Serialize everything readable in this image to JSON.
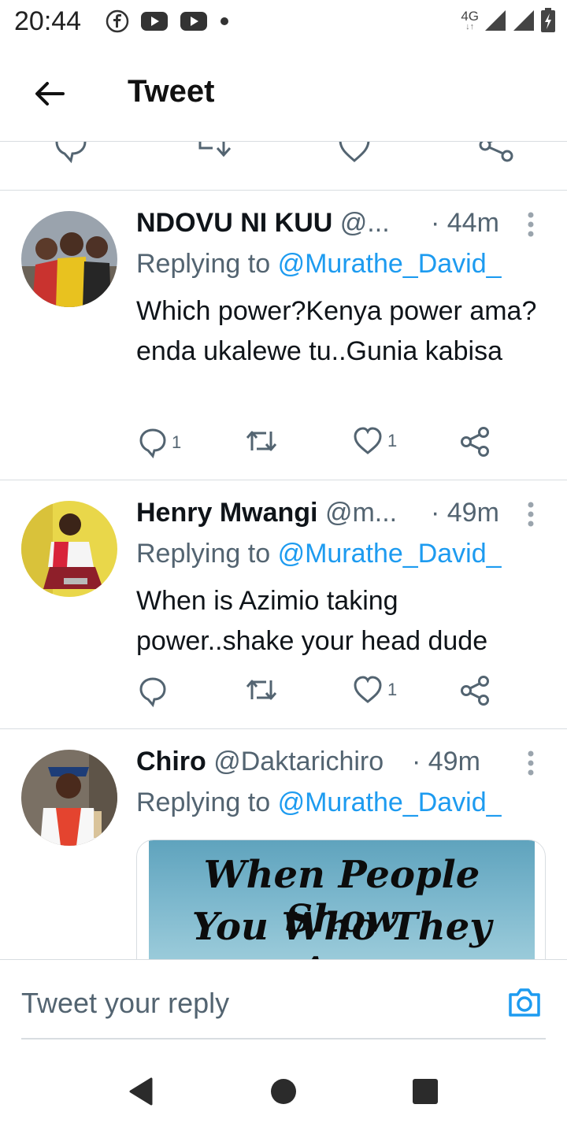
{
  "status_bar": {
    "time": "20:44",
    "left_icons": [
      "facebook-icon",
      "youtube-icon",
      "youtube-icon",
      "dot-icon"
    ],
    "network": "4G",
    "right_icons": [
      "signal-icon",
      "signal-icon",
      "battery-charging-icon"
    ]
  },
  "header": {
    "title": "Tweet",
    "back_icon": "back-arrow-icon"
  },
  "tweets": [
    {
      "name": "NDOVU NI KUU",
      "handle": "@...",
      "time": "· 44m",
      "replying_prefix": "Replying to",
      "replying_to": "@Murathe_David_",
      "text": "Which power?Kenya power ama?enda ukalewe tu..Gunia kabisa",
      "replies": "1",
      "retweets": "",
      "likes": "1"
    },
    {
      "name": "Henry Mwangi",
      "handle": "@m...",
      "time": "· 49m",
      "replying_prefix": "Replying to",
      "replying_to": "@Murathe_David_",
      "text": "When is Azimio taking power..shake your head dude",
      "replies": "",
      "retweets": "",
      "likes": "1"
    },
    {
      "name": "Chiro",
      "handle": "@Daktarichiro",
      "time": "· 49m",
      "replying_prefix": "Replying to",
      "replying_to": "@Murathe_David_",
      "media_text_line1": "When People Show",
      "media_text_line2": "You Who They Are,"
    }
  ],
  "reply_bar": {
    "placeholder": "Tweet your reply",
    "camera_icon": "camera-icon"
  },
  "nav_bar": {
    "buttons": [
      "back-triangle-icon",
      "home-circle-icon",
      "recents-square-icon"
    ]
  },
  "colors": {
    "accent": "#1d9bf0",
    "secondary_text": "#536471",
    "divider": "#d8dde1"
  }
}
